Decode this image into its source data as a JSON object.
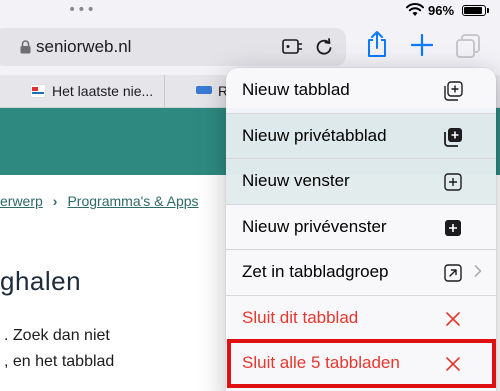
{
  "status_bar": {
    "battery_text": "96%",
    "battery_level": 0.96,
    "more_dots": "•••"
  },
  "toolbar": {
    "url": "seniorweb.nl"
  },
  "tabs": [
    {
      "title": "Het laatste nie..."
    },
    {
      "title": "R"
    }
  ],
  "page": {
    "breadcrumb": [
      "erwerp",
      "Programma's & Apps"
    ],
    "heading": "ghalen",
    "body_lines": [
      ". Zoek dan niet",
      ", en het tabblad"
    ]
  },
  "menu": {
    "items": [
      {
        "label": "Nieuw tabblad",
        "icon": "new-tab-icon"
      },
      {
        "label": "Nieuw privétabblad",
        "icon": "private-tab-icon"
      },
      {
        "label": "Nieuw venster",
        "icon": "new-window-icon"
      },
      {
        "label": "Nieuw privévenster",
        "icon": "private-window-icon"
      },
      {
        "label": "Zet in tabbladgroep",
        "icon": "move-to-group-icon"
      },
      {
        "label": "Sluit dit tabblad",
        "icon": "close-icon"
      },
      {
        "label": "Sluit alle 5 tabbladen",
        "icon": "close-icon"
      }
    ]
  },
  "colors": {
    "accent": "#2e8a80",
    "destructive": "#e5372e",
    "highlight": "#e01010",
    "ios_blue": "#0a7aff"
  }
}
